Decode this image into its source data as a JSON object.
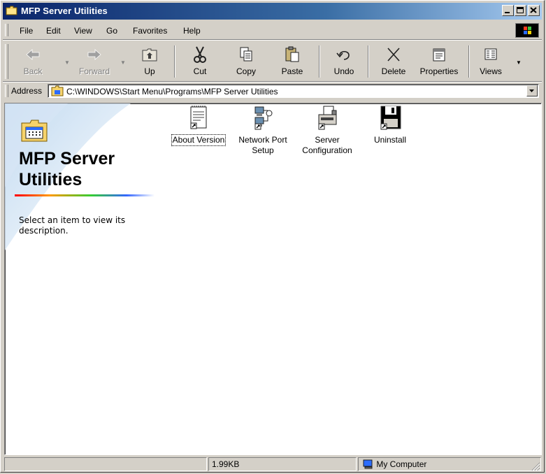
{
  "window": {
    "title": "MFP Server Utilities",
    "controls": [
      "minimize",
      "maximize",
      "close"
    ]
  },
  "menu": {
    "items": [
      {
        "label": "File",
        "key": "F"
      },
      {
        "label": "Edit",
        "key": "E"
      },
      {
        "label": "View",
        "key": "V"
      },
      {
        "label": "Go",
        "key": "G"
      },
      {
        "label": "Favorites",
        "key": "a"
      },
      {
        "label": "Help",
        "key": "H"
      }
    ]
  },
  "toolbar": {
    "back": "Back",
    "forward": "Forward",
    "up": "Up",
    "cut": "Cut",
    "copy": "Copy",
    "paste": "Paste",
    "undo": "Undo",
    "delete": "Delete",
    "properties": "Properties",
    "views": "Views"
  },
  "address": {
    "label": "Address",
    "value": "C:\\WINDOWS\\Start Menu\\Programs\\MFP Server Utilities"
  },
  "infopane": {
    "title": "MFP Server Utilities",
    "description": "Select an item to view its description."
  },
  "files": [
    {
      "label": "About Version",
      "icon": "document-icon",
      "focused": true
    },
    {
      "label": "Network Port Setup",
      "icon": "network-computers-icon",
      "focused": false
    },
    {
      "label": "Server Configuration",
      "icon": "printer-icon",
      "focused": false
    },
    {
      "label": "Uninstall",
      "icon": "floppy-disk-icon",
      "focused": false
    }
  ],
  "status": {
    "size": "1.99KB",
    "zone": "My Computer"
  },
  "colors": {
    "titlebar_start": "#0a246a",
    "titlebar_end": "#a6caf0",
    "face": "#d4d0c8"
  }
}
